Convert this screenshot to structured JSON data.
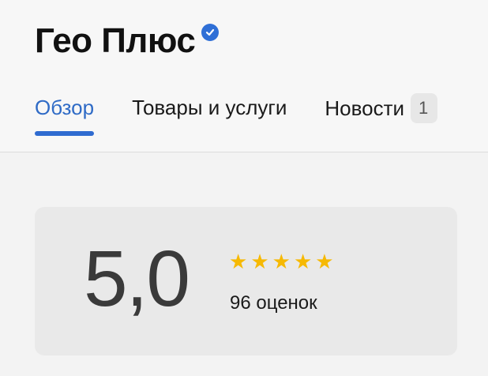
{
  "company": {
    "name": "Гео Плюс",
    "verified_icon": "verified-check-icon"
  },
  "tabs": [
    {
      "label": "Обзор",
      "active": true
    },
    {
      "label": "Товары и услуги",
      "active": false
    },
    {
      "label": "Новости",
      "active": false,
      "badge": "1"
    }
  ],
  "rating": {
    "score": "5,0",
    "stars_filled": 5,
    "stars_total": 5,
    "star_color": "#f6b903",
    "reviews_text": "96 оценок"
  },
  "colors": {
    "accent": "#2f6bc6"
  }
}
